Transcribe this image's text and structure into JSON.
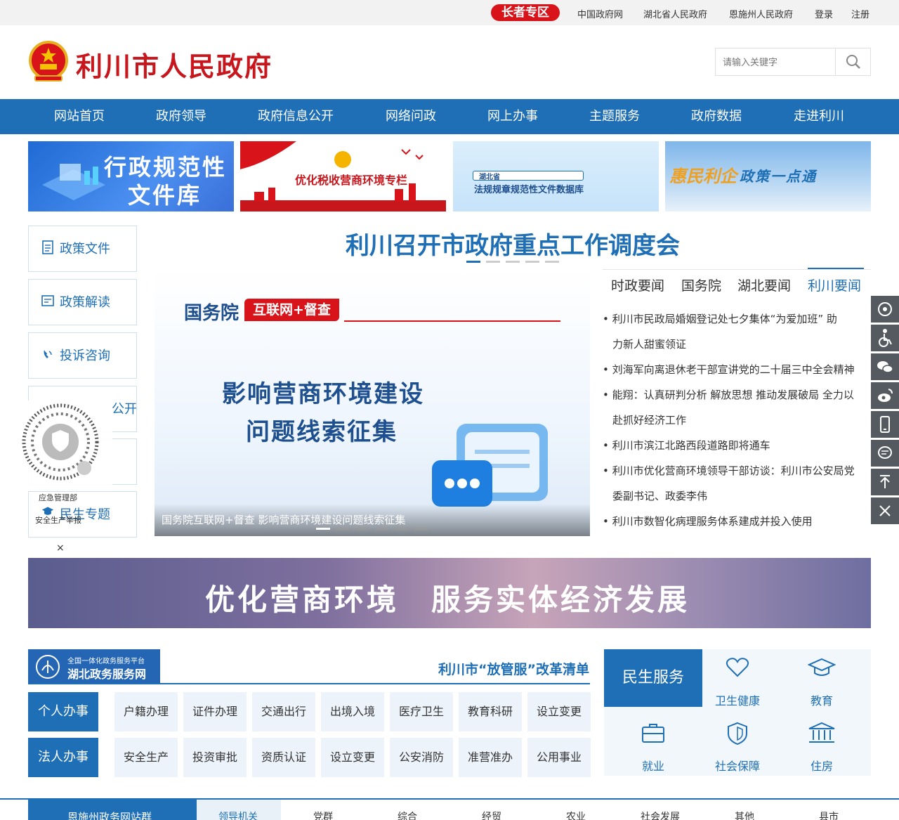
{
  "topbar": {
    "elder": "长者专区",
    "links": [
      "中国政府网",
      "湖北省人民政府",
      "恩施州人民政府",
      "登录",
      "注册"
    ]
  },
  "header": {
    "title": "利川市人民政府",
    "search_placeholder": "请输入关键字"
  },
  "nav": [
    "网站首页",
    "政府领导",
    "政府信息公开",
    "网络问政",
    "网上办事",
    "主题服务",
    "政府数据",
    "走进利川"
  ],
  "banners": {
    "b1": [
      "行政规范性",
      "文件库"
    ],
    "b2": "优化税收营商环境专栏",
    "b3": {
      "label": "湖北省",
      "text": "法规规章规范性文件数据库"
    },
    "b4": [
      "惠民利企",
      "政策一点通"
    ]
  },
  "sidebar": [
    "政策文件",
    "政策解读",
    "投诉咨询",
    "公开",
    "",
    "民生专题"
  ],
  "qr": {
    "label1": "应急管理部",
    "label2": "安全生产举报",
    "close": "×"
  },
  "headline": "利川召开市政府重点工作调度会",
  "carousel": {
    "brand": "国务院",
    "tag": "互联网+督查",
    "line1": "影响营商环境建设",
    "line2": "问题线索征集",
    "caption": "国务院互联网+督查 影响营商环境建设问题线索征集"
  },
  "news": {
    "tabs": [
      "时政要闻",
      "国务院",
      "湖北要闻",
      "利川要闻"
    ],
    "lines": [
      "利川市民政局婚姻登记处七夕集体“为爱加班” 助",
      "力新人甜蜜领证",
      "刘海军向离退休老干部宣讲党的二十届三中全会精神",
      "能翔：认真研判分析 解放思想 推动发展破局 全力以",
      "赴抓好经济工作",
      "利川市滨江北路西段道路即将通车",
      "利川市优化营商环境领导干部访谈：利川市公安局党",
      "委副书记、政委李伟",
      "利川市数智化病理服务体系建成并投入使用"
    ]
  },
  "bigbanner": "优化营商环境　服务实体经济发展",
  "service": {
    "platform_small": "全国一体化政务服务平台",
    "platform": "湖北政务服务网",
    "reform": "利川市“放管服”改革清单",
    "personal": "个人办事",
    "corporate": "法人办事",
    "row1": [
      "户籍办理",
      "证件办理",
      "交通出行",
      "出境入境",
      "医疗卫生",
      "教育科研",
      "设立变更"
    ],
    "row2": [
      "安全生产",
      "投资审批",
      "资质认证",
      "设立变更",
      "公安消防",
      "准营准办",
      "公用事业"
    ]
  },
  "minsheng": {
    "title": "民生服务",
    "items": [
      "卫生健康",
      "教育",
      "就业",
      "社会保障",
      "住房"
    ]
  },
  "bottom": {
    "group": "恩施州政务网站群",
    "tabs": [
      "领导机关",
      "党群",
      "综合",
      "经贸",
      "农业",
      "社会发展",
      "其他",
      "县市"
    ]
  }
}
